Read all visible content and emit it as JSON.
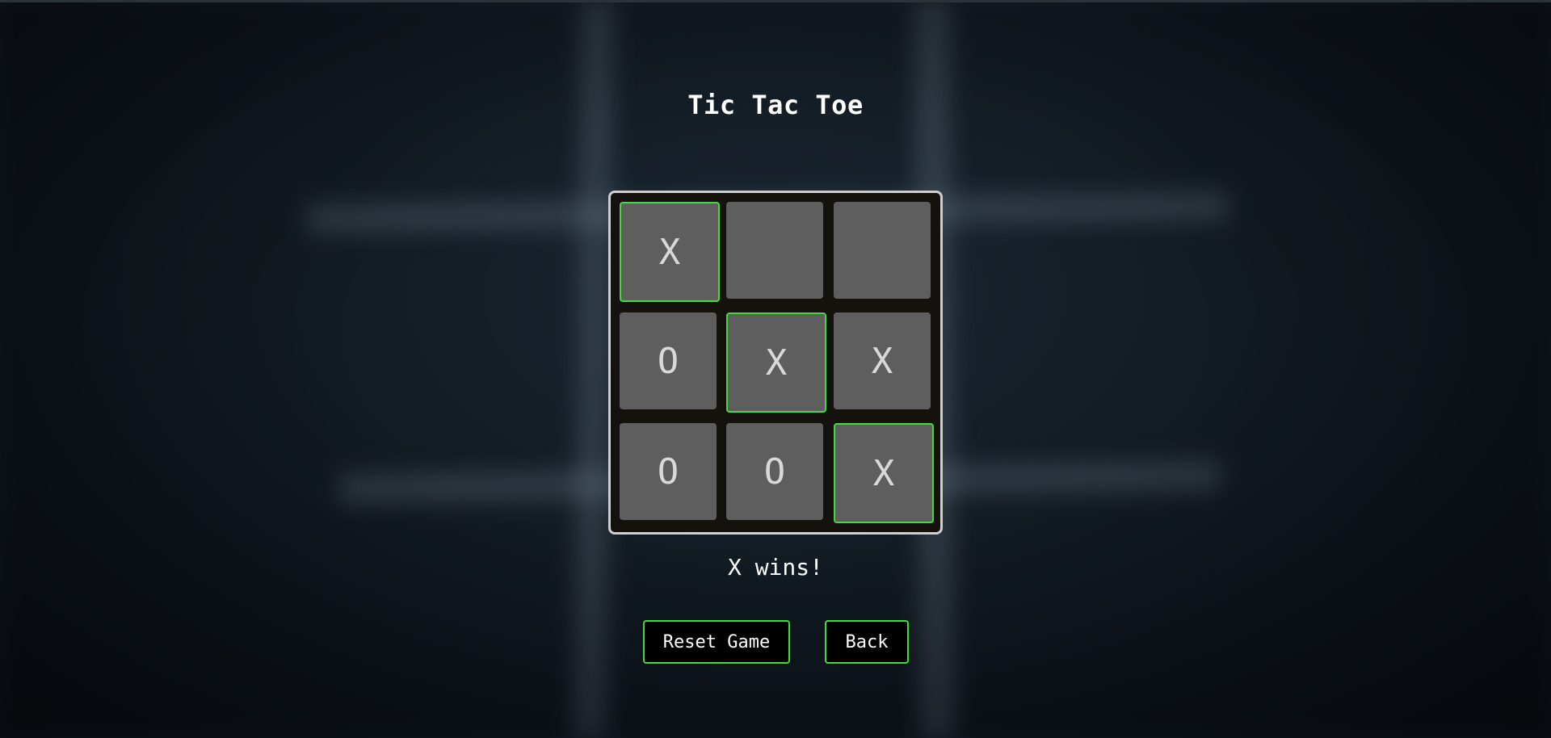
{
  "page": {
    "title": "Tic Tac Toe"
  },
  "board": {
    "cells": [
      {
        "value": "X",
        "winning": true
      },
      {
        "value": "",
        "winning": false
      },
      {
        "value": "",
        "winning": false
      },
      {
        "value": "O",
        "winning": false
      },
      {
        "value": "X",
        "winning": true
      },
      {
        "value": "X",
        "winning": false
      },
      {
        "value": "O",
        "winning": false
      },
      {
        "value": "O",
        "winning": false
      },
      {
        "value": "X",
        "winning": true
      }
    ]
  },
  "status": {
    "message": "X wins!"
  },
  "controls": {
    "reset_label": "Reset Game",
    "back_label": "Back"
  },
  "colors": {
    "accent": "#3fdc3f",
    "cell_background": "#5e5e5e",
    "board_background": "#15110d",
    "board_border": "#cfcfcf",
    "mark_color": "#d9d9d9"
  }
}
